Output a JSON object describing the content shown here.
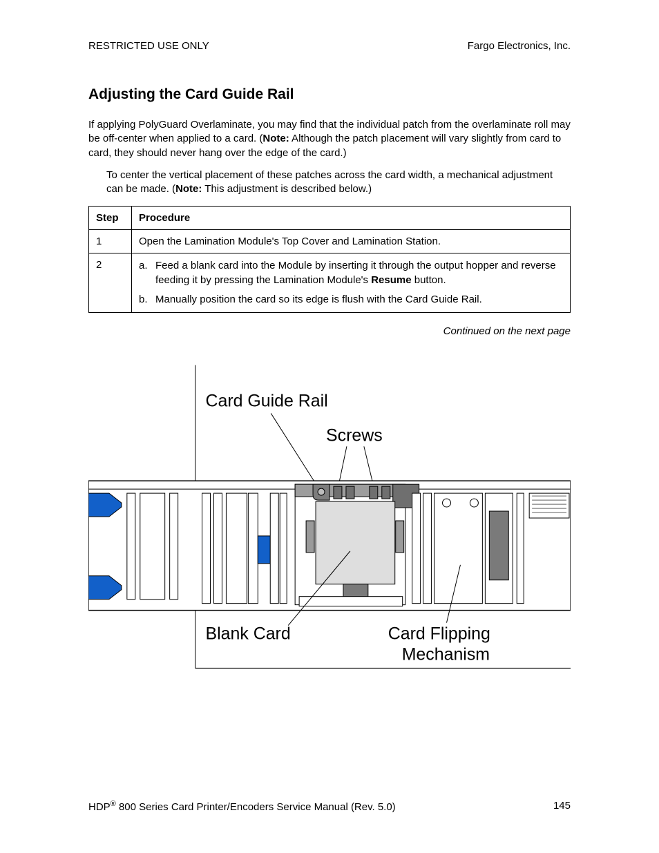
{
  "header": {
    "left": "RESTRICTED USE ONLY",
    "right": "Fargo Electronics, Inc."
  },
  "title": "Adjusting the Card Guide Rail",
  "intro": {
    "p1_a": "If applying PolyGuard Overlaminate, you may find that the individual patch from the overlaminate roll may be off-center when applied to a card. (",
    "p1_note": "Note:",
    "p1_b": "  Although the patch placement will vary slightly from card to card, they should never hang over the edge of the card.)",
    "p2_a": "To center the vertical placement of these patches across the card width, a mechanical adjustment can be made. (",
    "p2_note": "Note:",
    "p2_b": "  This adjustment is described below.)"
  },
  "table": {
    "headers": {
      "step": "Step",
      "procedure": "Procedure"
    },
    "rows": [
      {
        "step": "1",
        "text": "Open the Lamination Module's Top Cover and Lamination Station."
      },
      {
        "step": "2",
        "a_letter": "a.",
        "a_pre": "Feed a blank card into the Module by inserting it through the output hopper and reverse feeding it by pressing the Lamination Module's ",
        "a_strong": "Resume",
        "a_post": " button.",
        "b_letter": "b.",
        "b_text": "Manually position the card so its edge is flush with the Card Guide Rail."
      }
    ]
  },
  "continued": "Continued on the next page",
  "diagram": {
    "labels": {
      "card_guide_rail": "Card Guide Rail",
      "screws": "Screws",
      "blank_card": "Blank Card",
      "card_flipping": "Card Flipping",
      "mechanism": "Mechanism"
    }
  },
  "footer": {
    "left_a": "HDP",
    "left_reg": "®",
    "left_b": " 800 Series Card Printer/Encoders Service Manual (Rev. 5.0)",
    "page": "145"
  }
}
